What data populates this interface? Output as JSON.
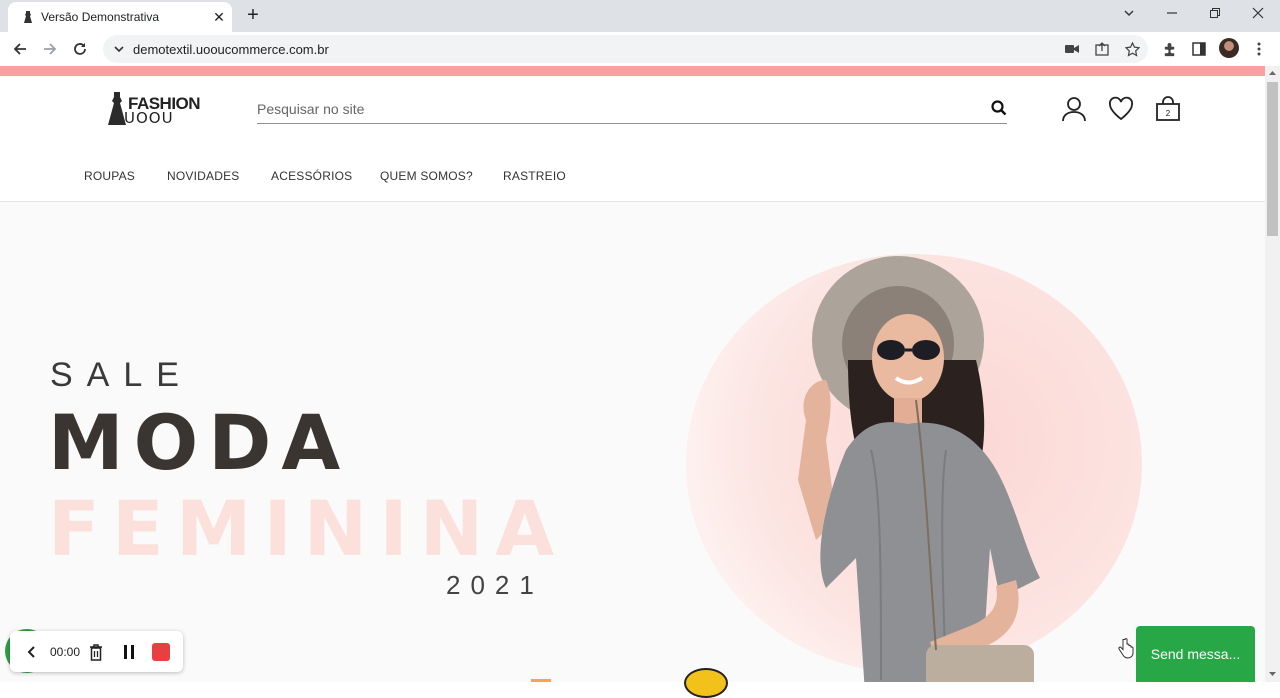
{
  "browser": {
    "tab_title": "Versão Demonstrativa",
    "url": "demotextil.uooucommerce.com.br"
  },
  "site": {
    "logo_top": "FASHION",
    "logo_bottom": "UOOU",
    "search_placeholder": "Pesquisar no site",
    "menu": [
      "ROUPAS",
      "NOVIDADES",
      "ACESSÓRIOS",
      "QUEM SOMOS?",
      "RASTREIO"
    ]
  },
  "hero": {
    "sale": "SALE",
    "moda": "MODA",
    "feminina": "FEMININA",
    "year": "2021"
  },
  "recorder": {
    "time": "00:00"
  },
  "chat": {
    "send_label": "Send messa..."
  },
  "colors": {
    "promo_bar": "#f7a1a1",
    "chat_green": "#27a745",
    "record_red": "#e84040"
  }
}
